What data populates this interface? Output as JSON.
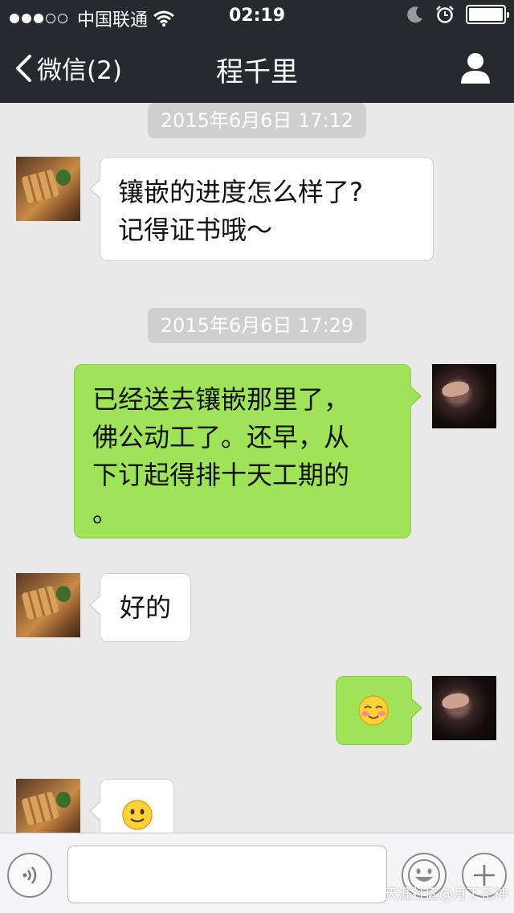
{
  "status_bar": {
    "carrier": "中国联通",
    "time": "02:19"
  },
  "nav": {
    "back_label": "微信(2)",
    "title": "程千里"
  },
  "messages": [
    {
      "type": "timestamp",
      "text": "2015年6月6日 17:12"
    },
    {
      "type": "incoming",
      "text": "镶嵌的进度怎么样了?\n记得证书哦～"
    },
    {
      "type": "timestamp",
      "text": "2015年6月6日 17:29"
    },
    {
      "type": "outgoing",
      "text": "已经送去镶嵌那里了，\n佛公动工了。还早，从\n下订起得排十天工期的\n。"
    },
    {
      "type": "incoming",
      "text": "好的"
    },
    {
      "type": "outgoing",
      "emoji": "blush-emoji"
    },
    {
      "type": "incoming",
      "emoji": "smile-emoji"
    }
  ],
  "input_bar": {
    "voice_icon": "voice-icon",
    "emoji_icon": "emoji-icon",
    "plus_icon": "plus-icon"
  },
  "watermark": "天涯社区@月下花神",
  "colors": {
    "header_bg": "#26292e",
    "chat_bg": "#e9e9e9",
    "outgoing_bubble": "#9fe457",
    "incoming_bubble": "#ffffff",
    "timestamp_bg": "#cfcfcf"
  }
}
